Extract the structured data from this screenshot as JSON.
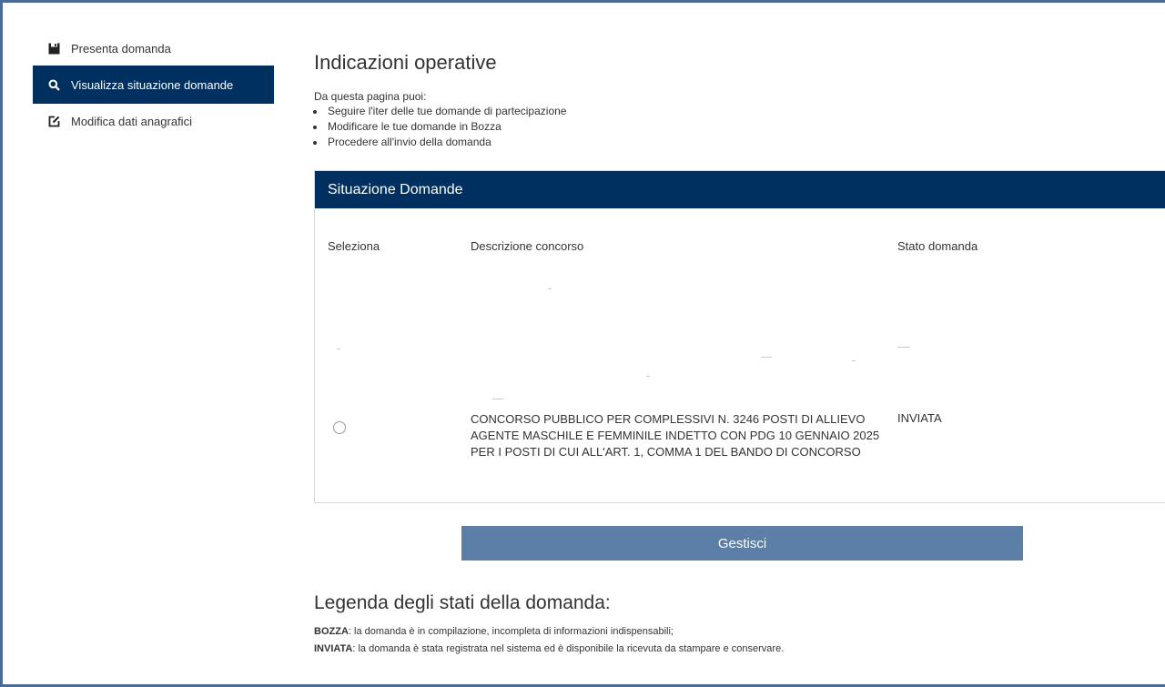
{
  "sidebar": {
    "items": [
      {
        "label": "Presenta domanda",
        "icon": "save-icon",
        "active": false
      },
      {
        "label": "Visualizza situazione domande",
        "icon": "search-icon",
        "active": true
      },
      {
        "label": "Modifica dati anagrafici",
        "icon": "edit-icon",
        "active": false
      }
    ]
  },
  "main": {
    "title": "Indicazioni operative",
    "intro": "Da questa pagina puoi:",
    "bullets": [
      "Seguire l'iter delle tue domande di partecipazione",
      "Modificare le tue domande in Bozza",
      "Procedere all'invio della domanda"
    ]
  },
  "panel": {
    "header": "Situazione Domande",
    "columns": [
      "Seleziona",
      "Descrizione concorso",
      "Stato domanda"
    ],
    "row": {
      "description": "CONCORSO PUBBLICO PER COMPLESSIVI N. 3246 POSTI DI ALLIEVO AGENTE MASCHILE E FEMMINILE INDETTO CON PDG 10 GENNAIO 2025 PER I POSTI DI CUI ALL'ART. 1, COMMA 1 DEL BANDO DI CONCORSO",
      "status": "INVIATA",
      "selected": false
    }
  },
  "actions": {
    "manage_label": "Gestisci"
  },
  "legend": {
    "title": "Legenda degli stati della domanda:",
    "items": [
      {
        "term": "BOZZA",
        "text": ": la domanda è in compilazione, incompleta di informazioni indispensabili;"
      },
      {
        "term": "INVIATA",
        "text": ": la domanda è stata registrata nel sistema ed è disponibile la ricevuta da stampare e conservare."
      }
    ]
  },
  "colors": {
    "navy": "#00305f",
    "button": "#5b7fa6",
    "frame": "#4a6b94"
  }
}
